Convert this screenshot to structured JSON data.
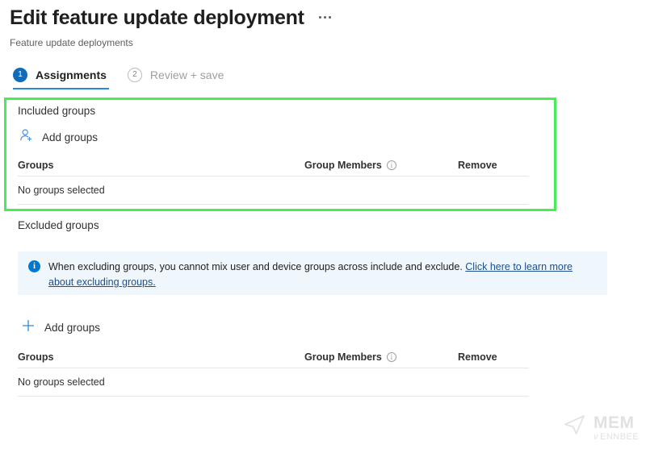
{
  "header": {
    "title": "Edit feature update deployment",
    "subtitle": "Feature update deployments",
    "overflow_icon": "ellipsis-icon"
  },
  "tabs": [
    {
      "number": "1",
      "label": "Assignments",
      "state": "active"
    },
    {
      "number": "2",
      "label": "Review + save",
      "state": "inactive"
    }
  ],
  "included": {
    "section_label": "Included groups",
    "add_groups_label": "Add groups",
    "add_groups_icon": "add-person-icon",
    "table": {
      "columns": [
        "Groups",
        "Group Members",
        "Remove"
      ],
      "empty_text": "No groups selected"
    }
  },
  "excluded": {
    "section_label": "Excluded groups",
    "add_groups_label": "Add groups",
    "add_groups_icon": "plus-icon",
    "table": {
      "columns": [
        "Groups",
        "Group Members",
        "Remove"
      ],
      "empty_text": "No groups selected"
    }
  },
  "info_banner": {
    "icon": "info-icon",
    "text": "When excluding groups, you cannot mix user and device groups across include and exclude. ",
    "link_text": "Click here to learn more about excluding groups."
  },
  "watermark": {
    "main": "MEM",
    "sub_italic": "v",
    "sub": "ENNBEE"
  },
  "colors": {
    "accent_blue": "#0f6cbd",
    "tab_underline": "#2b88d8",
    "highlight_green": "#44ee55",
    "banner_background": "#eff6fc",
    "link_blue": "#1b4f8f"
  }
}
